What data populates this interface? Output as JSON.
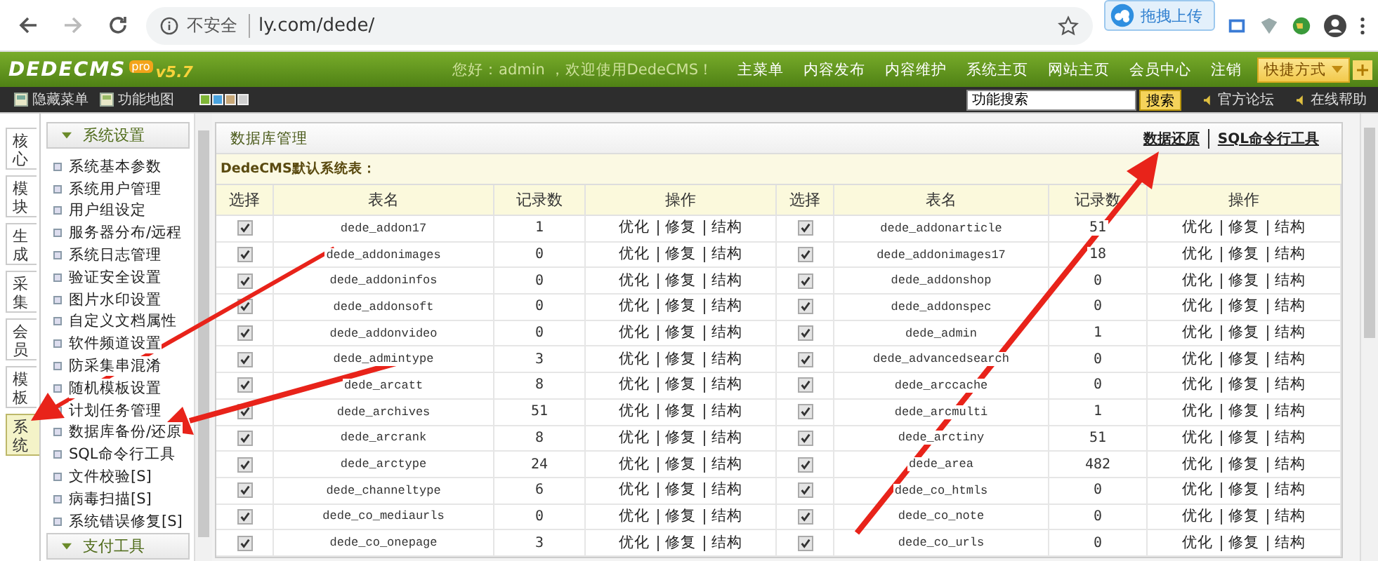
{
  "browser": {
    "security": "不安全",
    "url": "ly.com/dede/",
    "upload_badge": "拖拽上传"
  },
  "header": {
    "logo": "DEDECMS",
    "logo_badge": "pro",
    "version": "v5.7",
    "greeting": "您好：admin ，欢迎使用DedeCMS！",
    "nav": [
      "主菜单",
      "内容发布",
      "内容维护",
      "系统主页",
      "网站主页",
      "会员中心",
      "注销"
    ],
    "shortcut": "快捷方式"
  },
  "toolbar": {
    "links": [
      "隐藏菜单",
      "功能地图"
    ],
    "themes": [
      {
        "color": "#7fb636"
      },
      {
        "color": "#4aa3df"
      },
      {
        "color": "#c8a878"
      },
      {
        "color": "#cfcfcf"
      }
    ],
    "search": {
      "value": "功能搜索"
    },
    "search_button": "搜索",
    "links_right": [
      "官方论坛",
      "在线帮助"
    ]
  },
  "side_tabs": [
    {
      "label": "核心",
      "selected": false
    },
    {
      "label": "模块",
      "selected": false
    },
    {
      "label": "生成",
      "selected": false
    },
    {
      "label": "采集",
      "selected": false
    },
    {
      "label": "会员",
      "selected": false
    },
    {
      "label": "模板",
      "selected": false
    },
    {
      "label": "系统",
      "selected": true
    }
  ],
  "menu": [
    {
      "title": "系统设置",
      "items": [
        "系统基本参数",
        "系统用户管理",
        "用户组设定",
        "服务器分布/远程",
        "系统日志管理",
        "验证安全设置",
        "图片水印设置",
        "自定义文档属性",
        "软件频道设置",
        "防采集串混淆",
        "随机模板设置",
        "计划任务管理",
        "数据库备份/还原",
        "SQL命令行工具",
        "文件校验[S]",
        "病毒扫描[S]",
        "系统错误修复[S]"
      ]
    },
    {
      "title": "支付工具"
    }
  ],
  "panel": {
    "title": "数据库管理",
    "links": [
      "数据还原",
      "SQL命令行工具"
    ],
    "subtitle": "DedeCMS默认系统表：",
    "columns": [
      "选择",
      "表名",
      "记录数",
      "操作",
      "选择",
      "表名",
      "记录数",
      "操作"
    ],
    "rows": [
      {
        "left": {
          "checked": true,
          "name": "dede_addon17",
          "records": "1",
          "actions": [
            "优化",
            "修复",
            "结构"
          ]
        },
        "right": {
          "checked": true,
          "name": "dede_addonarticle",
          "records": "51",
          "actions": [
            "优化",
            "修复",
            "结构"
          ]
        }
      },
      {
        "left": {
          "checked": true,
          "name": "dede_addonimages",
          "records": "0",
          "actions": [
            "优化",
            "修复",
            "结构"
          ]
        },
        "right": {
          "checked": true,
          "name": "dede_addonimages17",
          "records": "18",
          "actions": [
            "优化",
            "修复",
            "结构"
          ]
        }
      },
      {
        "left": {
          "checked": true,
          "name": "dede_addoninfos",
          "records": "0",
          "actions": [
            "优化",
            "修复",
            "结构"
          ]
        },
        "right": {
          "checked": true,
          "name": "dede_addonshop",
          "records": "0",
          "actions": [
            "优化",
            "修复",
            "结构"
          ]
        }
      },
      {
        "left": {
          "checked": true,
          "name": "dede_addonsoft",
          "records": "0",
          "actions": [
            "优化",
            "修复",
            "结构"
          ]
        },
        "right": {
          "checked": true,
          "name": "dede_addonspec",
          "records": "0",
          "actions": [
            "优化",
            "修复",
            "结构"
          ]
        }
      },
      {
        "left": {
          "checked": true,
          "name": "dede_addonvideo",
          "records": "0",
          "actions": [
            "优化",
            "修复",
            "结构"
          ]
        },
        "right": {
          "checked": true,
          "name": "dede_admin",
          "records": "1",
          "actions": [
            "优化",
            "修复",
            "结构"
          ]
        }
      },
      {
        "left": {
          "checked": true,
          "name": "dede_admintype",
          "records": "3",
          "actions": [
            "优化",
            "修复",
            "结构"
          ]
        },
        "right": {
          "checked": true,
          "name": "dede_advancedsearch",
          "records": "0",
          "actions": [
            "优化",
            "修复",
            "结构"
          ]
        }
      },
      {
        "left": {
          "checked": true,
          "name": "dede_arcatt",
          "records": "8",
          "actions": [
            "优化",
            "修复",
            "结构"
          ]
        },
        "right": {
          "checked": true,
          "name": "dede_arccache",
          "records": "0",
          "actions": [
            "优化",
            "修复",
            "结构"
          ]
        }
      },
      {
        "left": {
          "checked": true,
          "name": "dede_archives",
          "records": "51",
          "actions": [
            "优化",
            "修复",
            "结构"
          ]
        },
        "right": {
          "checked": true,
          "name": "dede_arcmulti",
          "records": "1",
          "actions": [
            "优化",
            "修复",
            "结构"
          ]
        }
      },
      {
        "left": {
          "checked": true,
          "name": "dede_arcrank",
          "records": "8",
          "actions": [
            "优化",
            "修复",
            "结构"
          ]
        },
        "right": {
          "checked": true,
          "name": "dede_arctiny",
          "records": "51",
          "actions": [
            "优化",
            "修复",
            "结构"
          ]
        }
      },
      {
        "left": {
          "checked": true,
          "name": "dede_arctype",
          "records": "24",
          "actions": [
            "优化",
            "修复",
            "结构"
          ]
        },
        "right": {
          "checked": true,
          "name": "dede_area",
          "records": "482",
          "actions": [
            "优化",
            "修复",
            "结构"
          ]
        }
      },
      {
        "left": {
          "checked": true,
          "name": "dede_channeltype",
          "records": "6",
          "actions": [
            "优化",
            "修复",
            "结构"
          ]
        },
        "right": {
          "checked": true,
          "name": "dede_co_htmls",
          "records": "0",
          "actions": [
            "优化",
            "修复",
            "结构"
          ]
        }
      },
      {
        "left": {
          "checked": true,
          "name": "dede_co_mediaurls",
          "records": "0",
          "actions": [
            "优化",
            "修复",
            "结构"
          ]
        },
        "right": {
          "checked": true,
          "name": "dede_co_note",
          "records": "0",
          "actions": [
            "优化",
            "修复",
            "结构"
          ]
        }
      },
      {
        "left": {
          "checked": true,
          "name": "dede_co_onepage",
          "records": "3",
          "actions": [
            "优化",
            "修复",
            "结构"
          ]
        },
        "right": {
          "checked": true,
          "name": "dede_co_urls",
          "records": "0",
          "actions": [
            "优化",
            "修复",
            "结构"
          ]
        }
      }
    ]
  }
}
